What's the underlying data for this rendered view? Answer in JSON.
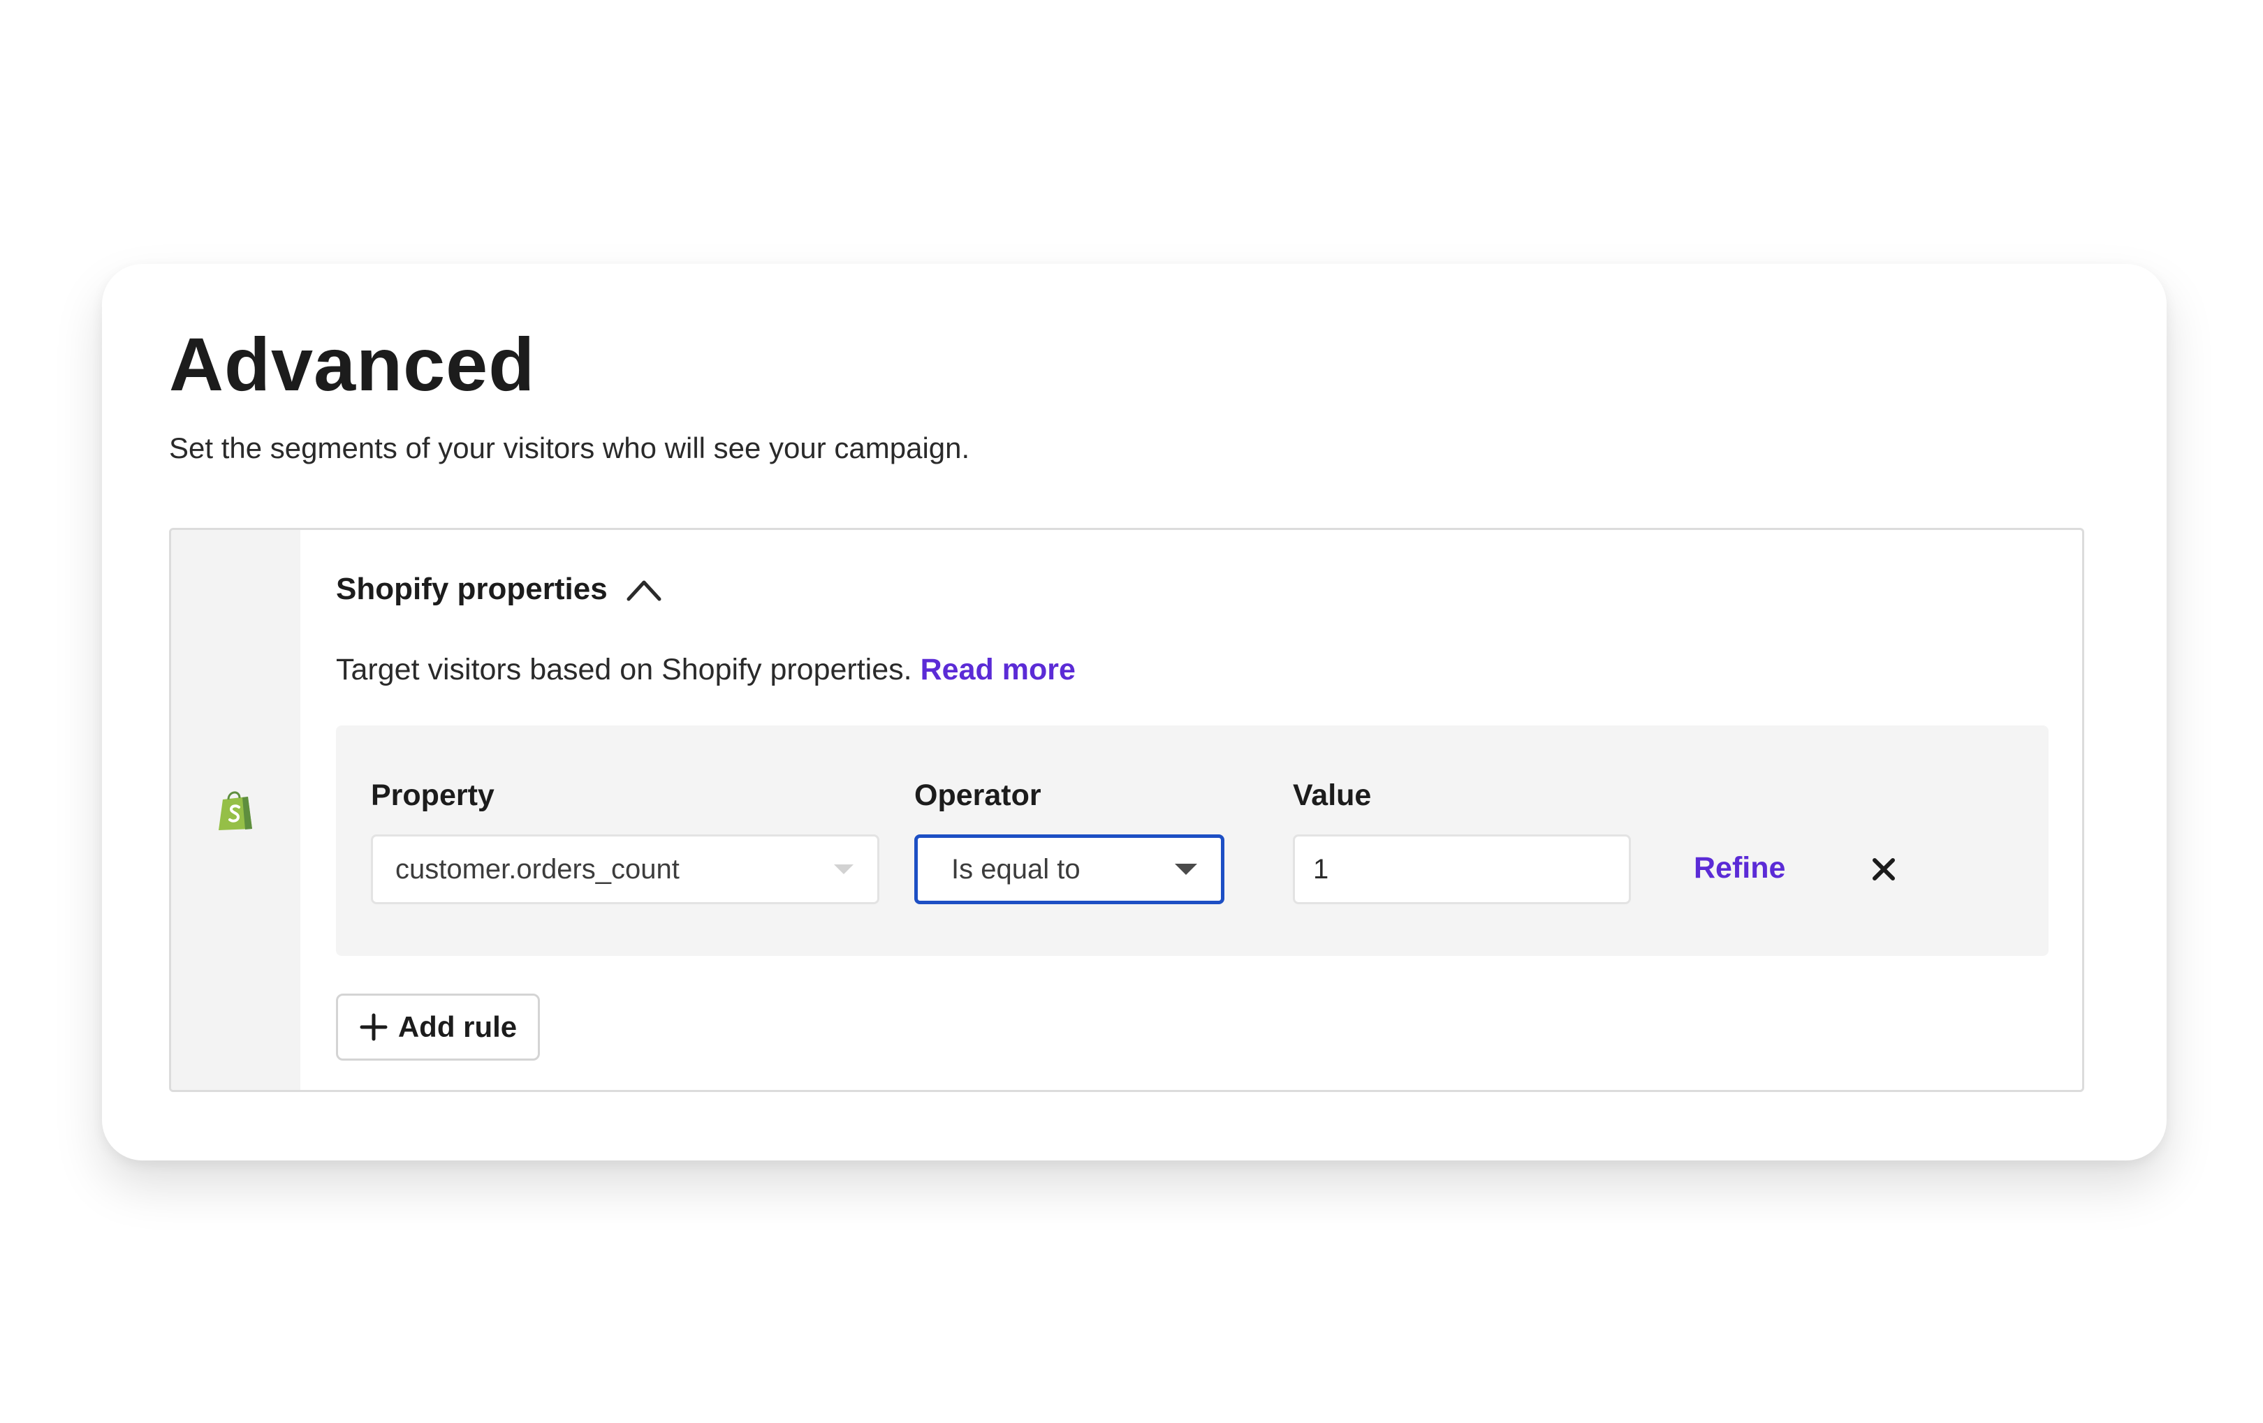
{
  "page": {
    "title": "Advanced",
    "subtitle": "Set the segments of your visitors who will see your campaign."
  },
  "section": {
    "title": "Shopify properties",
    "icon": "shopify-bag-icon",
    "toggle_icon": "chevron-up-icon",
    "expanded": true,
    "description": "Target visitors based on Shopify properties.",
    "read_more_label": "Read more"
  },
  "rule": {
    "property_label": "Property",
    "property_value": "customer.orders_count",
    "operator_label": "Operator",
    "operator_value": "Is equal to",
    "value_label": "Value",
    "value_value": "1",
    "refine_label": "Refine",
    "remove_icon": "close-icon"
  },
  "actions": {
    "add_rule_label": "Add rule",
    "add_rule_icon": "plus-icon"
  },
  "colors": {
    "accent": "#5b2bd6",
    "focus_border": "#1d4fc4",
    "shopify_green": "#95bf47"
  }
}
